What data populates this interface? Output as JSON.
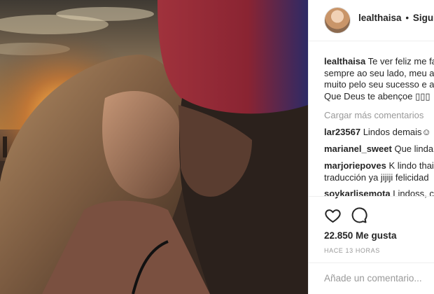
{
  "post": {
    "header": {
      "username": "lealthaisa",
      "separator": "•",
      "follow_label": "Siguie"
    },
    "caption": {
      "username": "lealthaisa",
      "lines": [
        "Te ver feliz me fa",
        "sempre ao seu lado, meu a",
        "muito pelo seu sucesso e a",
        "Que Deus te abençoe ▯▯▯"
      ]
    },
    "load_more_label": "Cargar más comentarios",
    "comments": [
      {
        "username": "lar23567",
        "text": "Lindos demais☺"
      },
      {
        "username": "marianel_sweet",
        "text": "Que linda!"
      },
      {
        "username": "marjoriepoves",
        "text": "K lindo thai",
        "text_line2": "traducción ya jijiji felicidad"
      },
      {
        "username": "soykarlisemota",
        "text": "Lindoss, cu"
      }
    ],
    "actions": {
      "like_icon": "heart-outline-icon",
      "comment_icon": "speech-bubble-icon"
    },
    "likes_label": "22.850 Me gusta",
    "timestamp": "HACE 13 HORAS",
    "add_comment_placeholder": "Añade un comentario..."
  }
}
